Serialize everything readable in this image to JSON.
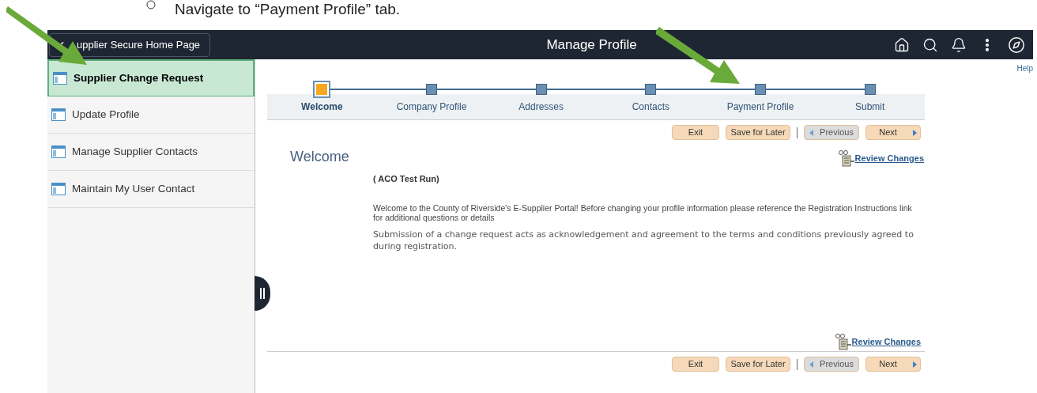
{
  "instruction": {
    "text": "Navigate to “Payment Profile” tab."
  },
  "header": {
    "back_button": "upplier Secure Home Page",
    "title": "Manage Profile"
  },
  "help_link": "Help",
  "sidebar": {
    "items": [
      {
        "label": "Supplier Change Request",
        "selected": true
      },
      {
        "label": "Update Profile",
        "selected": false
      },
      {
        "label": "Manage Supplier Contacts",
        "selected": false
      },
      {
        "label": "Maintain My User Contact",
        "selected": false
      }
    ]
  },
  "steps": [
    {
      "label": "Welcome",
      "selected": true
    },
    {
      "label": "Company Profile",
      "selected": false
    },
    {
      "label": "Addresses",
      "selected": false
    },
    {
      "label": "Contacts",
      "selected": false
    },
    {
      "label": "Payment Profile",
      "selected": false
    },
    {
      "label": "Submit",
      "selected": false
    }
  ],
  "top_buttons": [
    {
      "label": "Exit",
      "kind": "plain",
      "disabled": false
    },
    {
      "label": "Save for Later",
      "kind": "plain",
      "disabled": false
    },
    {
      "label": "Previous",
      "kind": "previous",
      "disabled": true
    },
    {
      "label": "Next",
      "kind": "next",
      "disabled": false
    }
  ],
  "review_link_top": "Review Changes",
  "heading": "Welcome",
  "subtitle": "( ACO Test Run)",
  "paragraphs": [
    "Welcome to the County of Riverside's E-Supplier Portal! Before changing your profile information please reference the Registration Instructions link for additional questions or details",
    "Submission of a change request acts as acknowledgement and agreement to the terms and conditions previously agreed to during registration."
  ],
  "review_link_bottom": "Review Changes",
  "bottom_buttons": [
    {
      "label": "Exit",
      "kind": "plain",
      "disabled": false
    },
    {
      "label": "Save for Later",
      "kind": "plain",
      "disabled": false
    },
    {
      "label": "Previous",
      "kind": "previous",
      "disabled": true
    },
    {
      "label": "Next",
      "kind": "next",
      "disabled": false
    }
  ]
}
